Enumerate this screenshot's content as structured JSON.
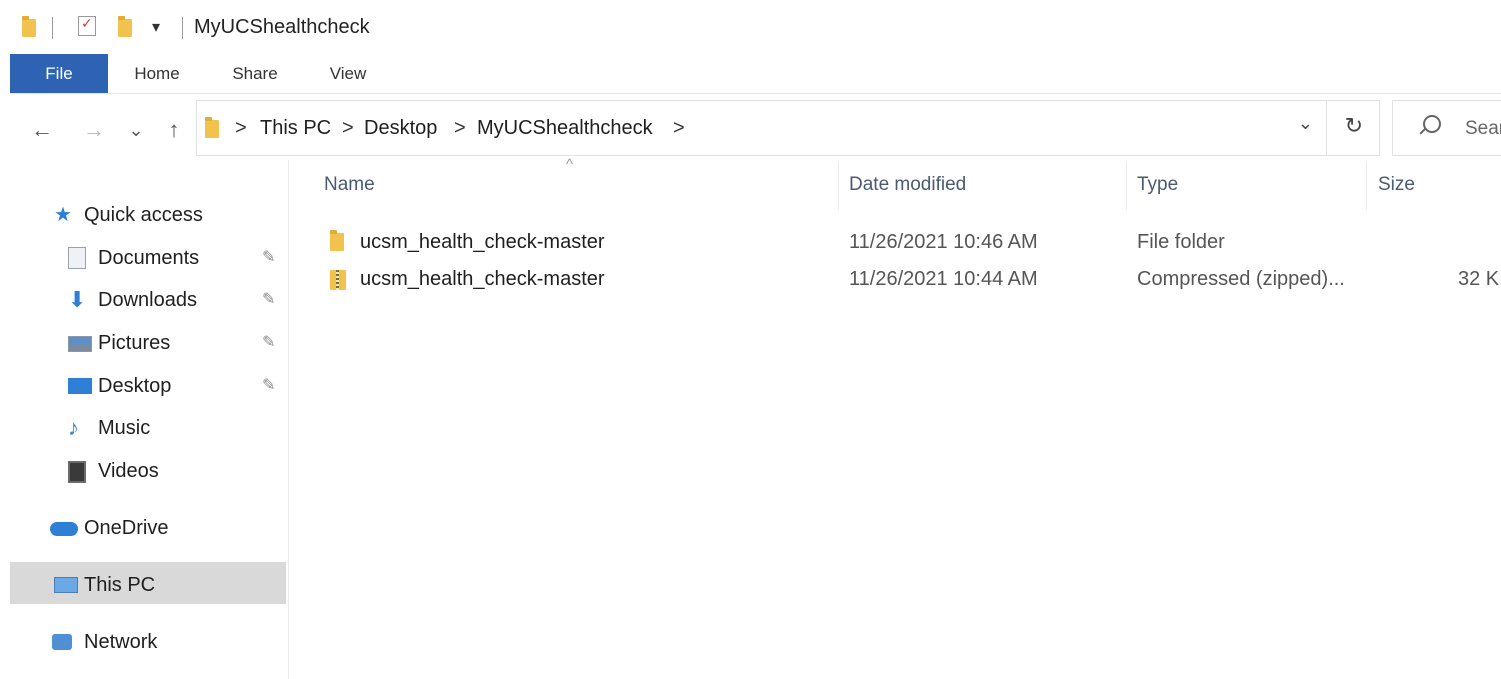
{
  "window": {
    "title": "MyUCShealthcheck",
    "qat_dropdown": "▾"
  },
  "ribbon": {
    "tabs": [
      "File",
      "Home",
      "Share",
      "View"
    ]
  },
  "navigation": {
    "back": "←",
    "forward": "→",
    "recent": "⌄",
    "up": "↑",
    "breadcrumb": [
      "This PC",
      "Desktop",
      "MyUCShealthcheck"
    ],
    "separator": ">",
    "dropdown": "⌄",
    "refresh": "↻",
    "search_placeholder": "Sear"
  },
  "nav_pane": {
    "quick_access": {
      "label": "Quick access",
      "items": [
        {
          "label": "Documents",
          "icon": "documents-icon",
          "pinned": true
        },
        {
          "label": "Downloads",
          "icon": "downloads-icon",
          "pinned": true
        },
        {
          "label": "Pictures",
          "icon": "pictures-icon",
          "pinned": true
        },
        {
          "label": "Desktop",
          "icon": "desktop-icon",
          "pinned": true
        },
        {
          "label": "Music",
          "icon": "music-icon",
          "pinned": false
        },
        {
          "label": "Videos",
          "icon": "videos-icon",
          "pinned": false
        }
      ]
    },
    "onedrive": "OneDrive",
    "this_pc": "This PC",
    "network": "Network"
  },
  "file_list": {
    "columns": {
      "name": "Name",
      "date": "Date modified",
      "type": "Type",
      "size": "Size"
    },
    "sort_indicator": "^",
    "rows": [
      {
        "name": "ucsm_health_check-master",
        "date": "11/26/2021 10:46 AM",
        "type": "File folder",
        "size": "",
        "icon": "folder-icon"
      },
      {
        "name": "ucsm_health_check-master",
        "date": "11/26/2021 10:44 AM",
        "type": "Compressed (zipped)...",
        "size": "32 K",
        "icon": "zip-folder-icon"
      }
    ]
  },
  "colors": {
    "file_tab": "#2d63b2",
    "folder": "#f1c24e",
    "selection": "#d9d9d9",
    "accent_blue": "#2f7fd6"
  }
}
